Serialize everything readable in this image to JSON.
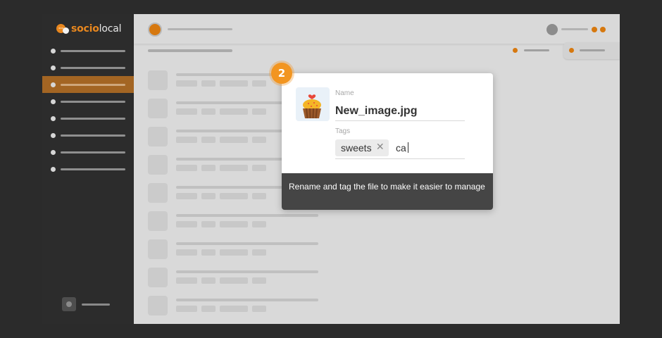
{
  "brand": {
    "part1": "socio",
    "part2": "local",
    "accent": "#e8871e"
  },
  "sidebar": {
    "items": [
      {
        "icon": "dot-icon",
        "active": false
      },
      {
        "icon": "dot-icon",
        "active": false
      },
      {
        "icon": "dot-icon",
        "active": true
      },
      {
        "icon": "dot-icon",
        "active": false
      },
      {
        "icon": "dot-icon",
        "active": false
      },
      {
        "icon": "dot-icon",
        "active": false
      },
      {
        "icon": "dot-icon",
        "active": false
      },
      {
        "icon": "dot-icon",
        "active": false
      }
    ],
    "active_color": "#a36523"
  },
  "dialog": {
    "name_label": "Name",
    "name_value": "New_image.jpg",
    "tags_label": "Tags",
    "tags": [
      "sweets"
    ],
    "tag_remove_icon": "close-icon",
    "tag_input_value": "ca",
    "thumbnail_icon": "cupcake-icon",
    "tip_text": "Rename and tag the file to make it easier to manage"
  },
  "step": {
    "number": "2",
    "color": "#f29520"
  }
}
